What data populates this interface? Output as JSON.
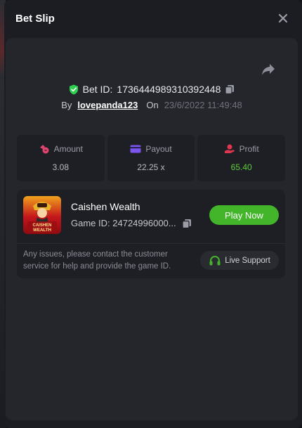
{
  "header": {
    "title": "Bet Slip"
  },
  "bet": {
    "id_label": "Bet ID:",
    "id_value": "1736444989310392448",
    "by_label": "By",
    "username": "lovepanda123",
    "on_label": "On",
    "timestamp": "23/6/2022 11:49:48"
  },
  "stats": [
    {
      "label": "Amount",
      "value": "3.08",
      "icon": "bag-icon"
    },
    {
      "label": "Payout",
      "value": "22.25 x",
      "icon": "card-icon"
    },
    {
      "label": "Profit",
      "value": "65.40",
      "icon": "hand-coin-icon"
    }
  ],
  "game": {
    "name": "Caishen Wealth",
    "id_label": "Game ID:",
    "id_value": "24724996000...",
    "thumb_text": "CAISHEN WEALTH",
    "play_label": "Play Now"
  },
  "support": {
    "text": "Any issues, please contact the customer service for help and provide the game ID.",
    "button_label": "Live Support"
  },
  "colors": {
    "accent_green": "#43b52a",
    "profit_green": "#5ecb3a",
    "shield_green": "#2fcf4f",
    "pink": "#e2446e",
    "purple": "#7b55f0",
    "red": "#e0364f"
  }
}
